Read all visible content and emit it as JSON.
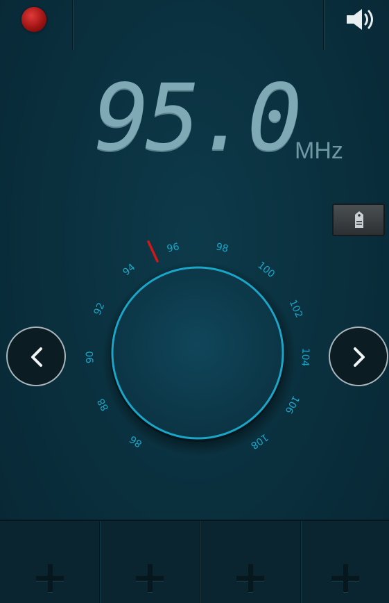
{
  "topbar": {
    "record_icon": "record-dot-icon",
    "volume_icon": "speaker-icon"
  },
  "tuner": {
    "frequency": "95.0",
    "unit": "MHz",
    "favorite_icon": "tag-icon"
  },
  "dial": {
    "scale_labels": [
      "86",
      "88",
      "90",
      "92",
      "94",
      "96",
      "98",
      "100",
      "102",
      "104",
      "106",
      "108"
    ],
    "needle_color": "#d01818",
    "accent_color": "#1aa6c8"
  },
  "navigation": {
    "prev_icon": "chevron-left-icon",
    "next_icon": "chevron-right-icon"
  },
  "presets": {
    "slots": [
      "add-icon",
      "add-icon",
      "add-icon",
      "add-icon"
    ]
  }
}
